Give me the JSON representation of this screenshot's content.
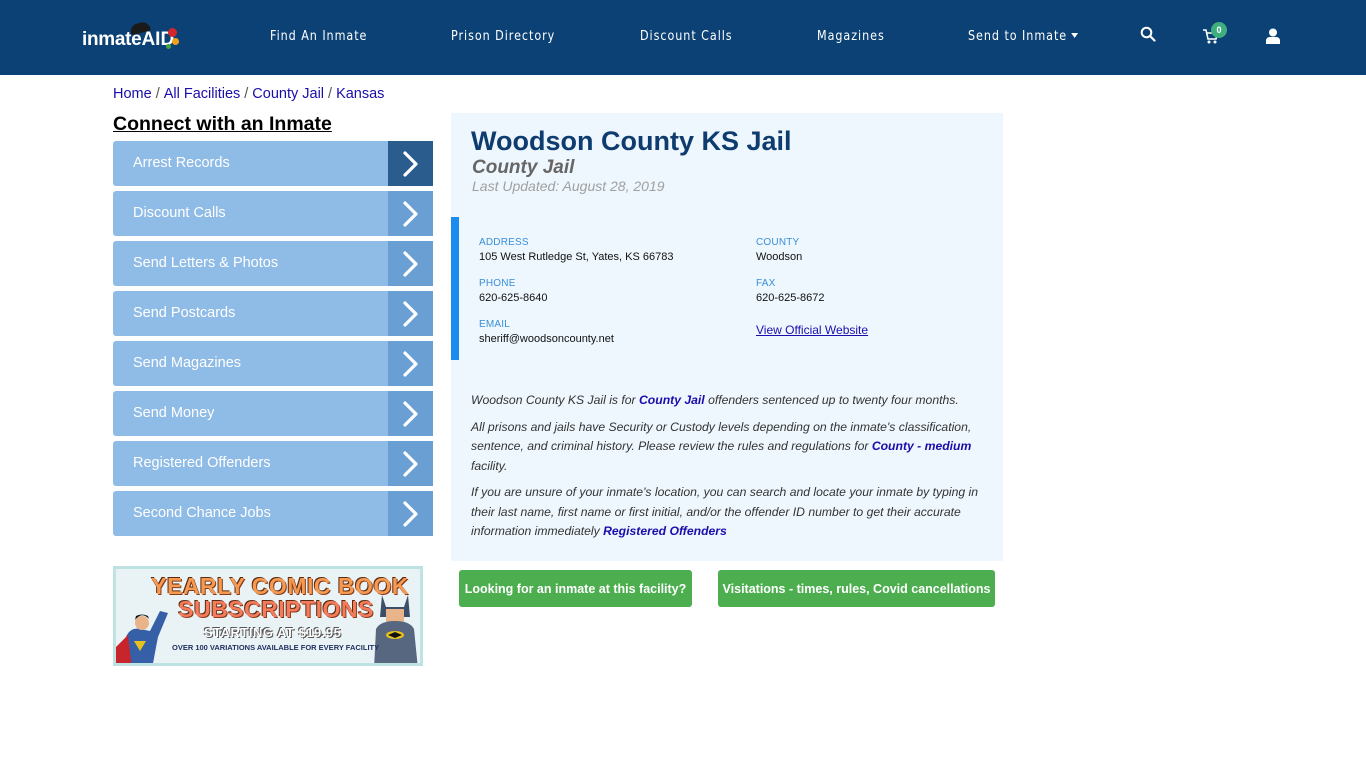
{
  "header": {
    "logo": {
      "text_main": "inmate",
      "text_accent": "AID"
    },
    "nav": [
      {
        "label": "Find An Inmate"
      },
      {
        "label": "Prison Directory"
      },
      {
        "label": "Discount Calls"
      },
      {
        "label": "Magazines"
      },
      {
        "label": "Send to Inmate",
        "has_dropdown": true
      }
    ],
    "icons": {
      "search": "search-icon",
      "cart": "cart-icon",
      "user": "user-icon"
    },
    "cart_count": "0",
    "colors": {
      "background": "#0b4174",
      "badge": "#3fae7e"
    }
  },
  "breadcrumb": [
    {
      "label": "Home"
    },
    {
      "label": "All Facilities"
    },
    {
      "label": "County Jail"
    },
    {
      "label": "Kansas"
    }
  ],
  "sidebar": {
    "title": "Connect with an Inmate",
    "items": [
      {
        "label": "Arrest Records"
      },
      {
        "label": "Discount Calls"
      },
      {
        "label": "Send Letters & Photos"
      },
      {
        "label": "Send Postcards"
      },
      {
        "label": "Send Magazines"
      },
      {
        "label": "Send Money"
      },
      {
        "label": "Registered Offenders"
      },
      {
        "label": "Second Chance Jobs"
      }
    ],
    "ad": {
      "line1": "YEARLY COMIC BOOK",
      "line2": "SUBSCRIPTIONS",
      "line3": "STARTING AT $19.95",
      "line4": "OVER 100 VARIATIONS AVAILABLE FOR EVERY FACILITY"
    }
  },
  "facility": {
    "name": "Woodson County KS Jail",
    "type": "County Jail",
    "last_updated": "Last Updated: August 28, 2019",
    "address_label": "ADDRESS",
    "address": "105 West Rutledge St, Yates, KS 66783",
    "county_label": "COUNTY",
    "county": "Woodson",
    "phone_label": "PHONE",
    "phone": "620-625-8640",
    "fax_label": "FAX",
    "fax": "620-625-8672",
    "email_label": "EMAIL",
    "email": "sheriff@woodsoncounty.net",
    "website_link": "View Official Website"
  },
  "description": {
    "p1_before": "Woodson County KS Jail is for ",
    "p1_link": "County Jail",
    "p1_after": " offenders sentenced up to twenty four months.",
    "p2_before": "All prisons and jails have Security or Custody levels depending on the inmate's classification, sentence, and criminal history. Please review the rules and regulations for ",
    "p2_link": "County - medium",
    "p2_after": " facility.",
    "p3_before": "If you are unsure of your inmate's location, you can search and locate your inmate by typing in their last name, first name or first initial, and/or the offender ID number to get their accurate information immediately ",
    "p3_link": "Registered Offenders"
  },
  "actions": {
    "find_inmate": "Looking for an inmate at this facility?",
    "visitations": "Visitations - times, rules, Covid cancellations",
    "color": "#4cae4f"
  }
}
